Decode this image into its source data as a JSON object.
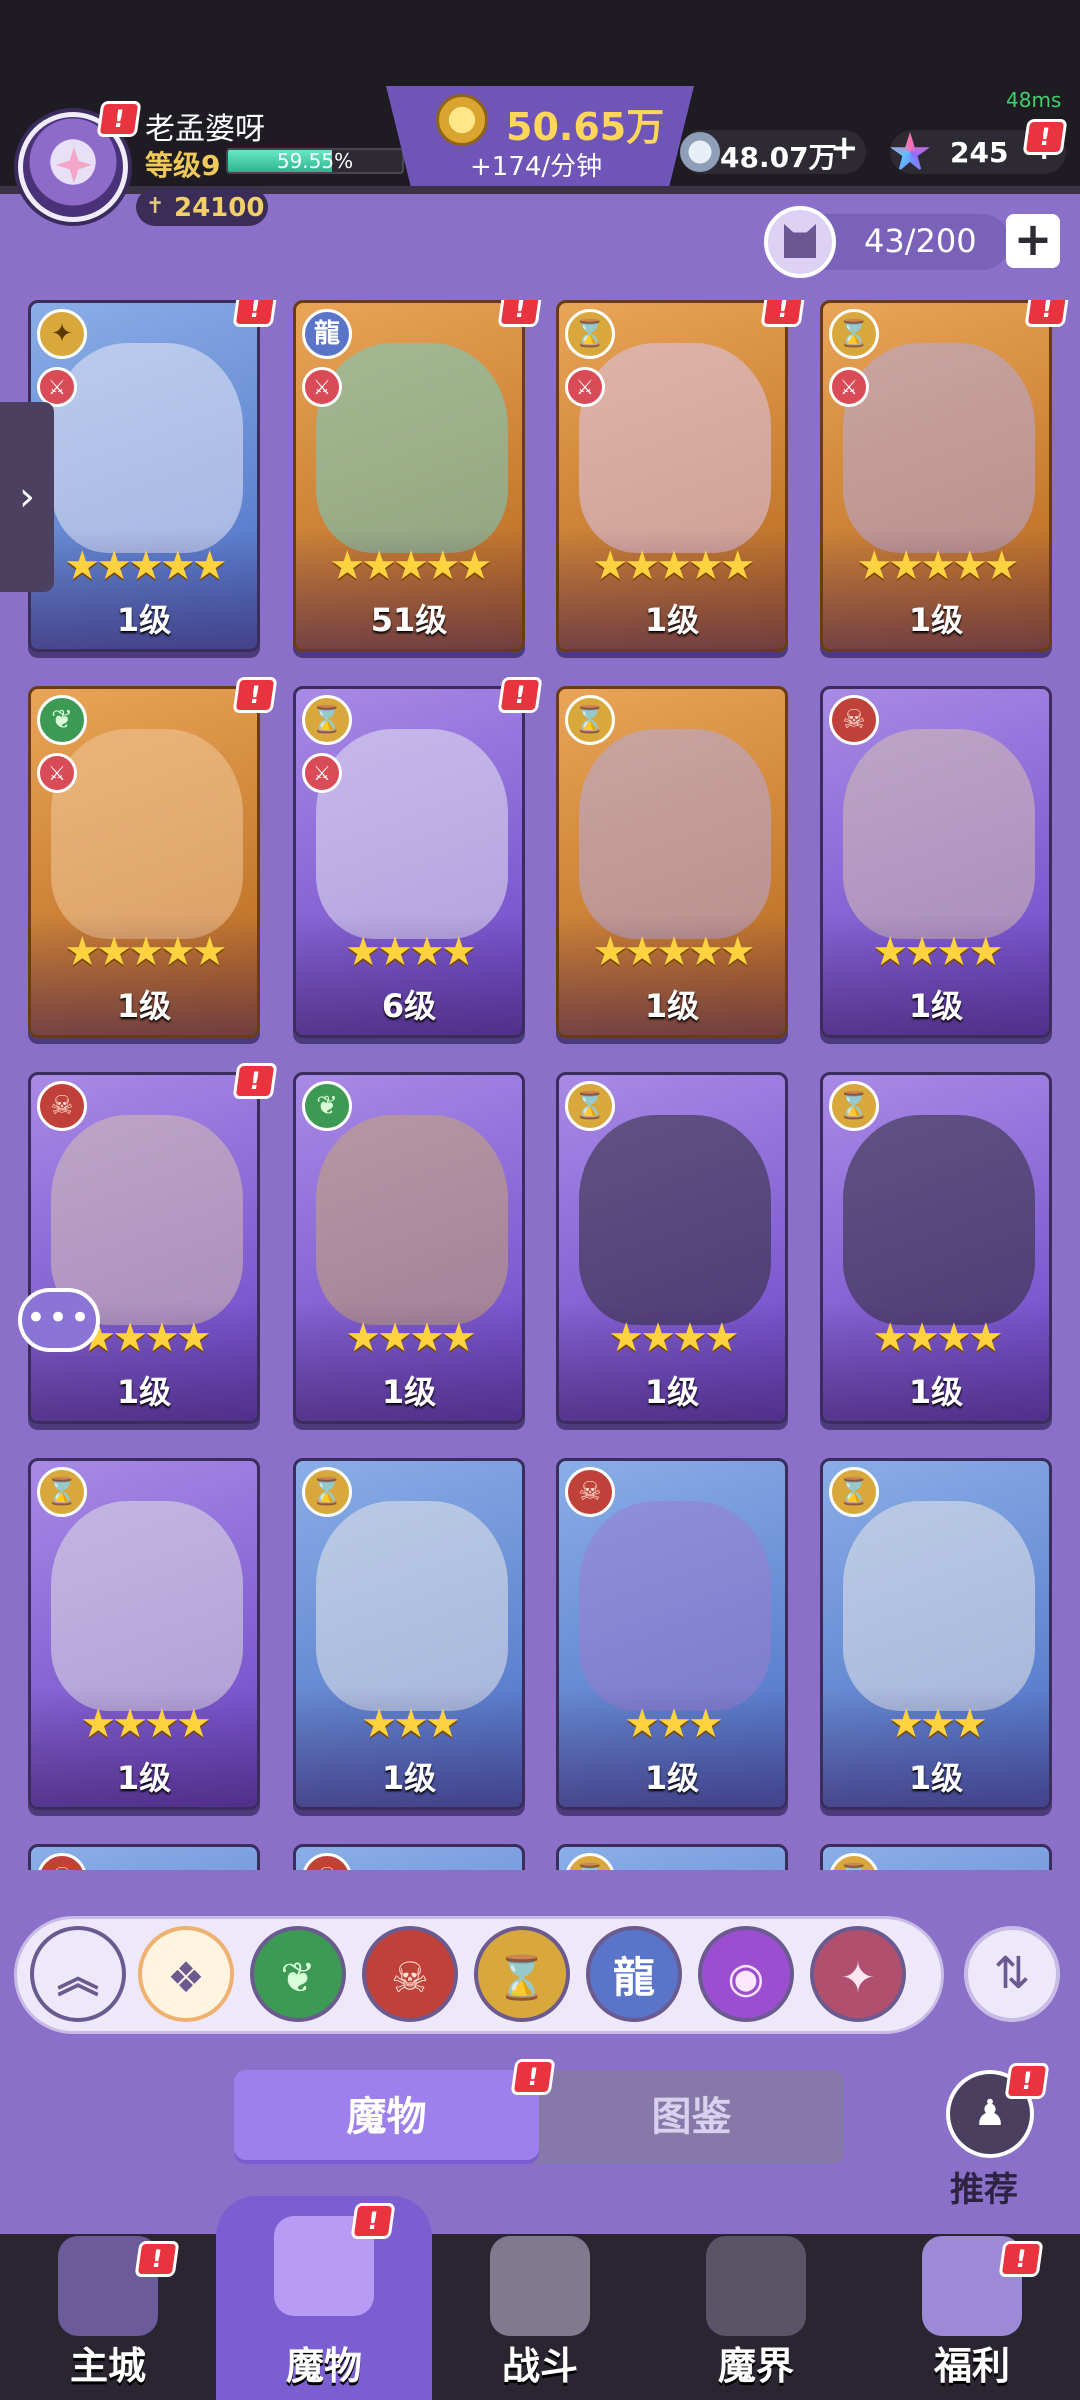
{
  "player": {
    "name": "老孟婆呀",
    "level": "等级9",
    "exp_text": "59.55%",
    "exp_fraction": 0.5955,
    "power": "24100"
  },
  "gold": {
    "amount": "50.65万",
    "rate": "+174/分钟"
  },
  "resources": [
    {
      "icon": "silver-coin-icon",
      "value": "48.07万"
    },
    {
      "icon": "star-crystal-icon",
      "value": "245"
    }
  ],
  "ping": "48ms",
  "capacity": {
    "text": "43/200"
  },
  "cards": [
    {
      "bg": "blue",
      "cls": "b-gold",
      "classIcon": "✦",
      "role": true,
      "stars": "★★★★★",
      "level": "1级",
      "alert": true
    },
    {
      "bg": "orange",
      "cls": "b-blue",
      "classIcon": "龍",
      "role": true,
      "stars": "★★★★★",
      "level": "51级",
      "alert": true
    },
    {
      "bg": "orange",
      "cls": "b-gold",
      "classIcon": "⌛",
      "role": true,
      "stars": "★★★★★",
      "level": "1级",
      "alert": true
    },
    {
      "bg": "orange",
      "cls": "b-gold",
      "classIcon": "⌛",
      "role": true,
      "stars": "★★★★★",
      "level": "1级",
      "alert": true
    },
    {
      "bg": "orange",
      "cls": "b-green",
      "classIcon": "❦",
      "role": true,
      "stars": "★★★★★",
      "level": "1级",
      "alert": true
    },
    {
      "bg": "purple",
      "cls": "b-gold",
      "classIcon": "⌛",
      "role": true,
      "stars": "★★★★",
      "level": "6级",
      "alert": true
    },
    {
      "bg": "orange",
      "cls": "b-gold",
      "classIcon": "⌛",
      "role": false,
      "stars": "★★★★★",
      "level": "1级",
      "alert": false
    },
    {
      "bg": "purple",
      "cls": "b-red",
      "classIcon": "☠",
      "role": false,
      "stars": "★★★★",
      "level": "1级",
      "alert": false
    },
    {
      "bg": "purple",
      "cls": "b-red",
      "classIcon": "☠",
      "role": false,
      "stars": "★★★★",
      "level": "1级",
      "alert": true
    },
    {
      "bg": "purple",
      "cls": "b-green",
      "classIcon": "❦",
      "role": false,
      "stars": "★★★★",
      "level": "1级",
      "alert": false
    },
    {
      "bg": "purple",
      "cls": "b-gold",
      "classIcon": "⌛",
      "role": false,
      "stars": "★★★★",
      "level": "1级",
      "alert": false
    },
    {
      "bg": "purple",
      "cls": "b-gold",
      "classIcon": "⌛",
      "role": false,
      "stars": "★★★★",
      "level": "1级",
      "alert": false
    },
    {
      "bg": "purple",
      "cls": "b-gold",
      "classIcon": "⌛",
      "role": false,
      "stars": "★★★★",
      "level": "1级",
      "alert": false
    },
    {
      "bg": "blue",
      "cls": "b-gold",
      "classIcon": "⌛",
      "role": false,
      "stars": "★★★",
      "level": "1级",
      "alert": false
    },
    {
      "bg": "blue",
      "cls": "b-red",
      "classIcon": "☠",
      "role": false,
      "stars": "★★★",
      "level": "1级",
      "alert": false
    },
    {
      "bg": "blue",
      "cls": "b-gold",
      "classIcon": "⌛",
      "role": false,
      "stars": "★★★",
      "level": "1级",
      "alert": false
    },
    {
      "bg": "blue",
      "cls": "b-red",
      "classIcon": "☠",
      "role": false,
      "stars": "",
      "level": "",
      "alert": false
    },
    {
      "bg": "blue",
      "cls": "b-red",
      "classIcon": "☠",
      "role": false,
      "stars": "",
      "level": "",
      "alert": false
    },
    {
      "bg": "blue",
      "cls": "b-gold",
      "classIcon": "⌛",
      "role": false,
      "stars": "",
      "level": "",
      "alert": false
    },
    {
      "bg": "blue",
      "cls": "b-gold",
      "classIcon": "⌛",
      "role": false,
      "stars": "",
      "level": "",
      "alert": false
    }
  ],
  "filters": [
    {
      "icon": "collapse-up-icon",
      "glyph": "︽",
      "color": "#ede8fa",
      "fg": "#6b5a8f"
    },
    {
      "icon": "all-types-icon",
      "glyph": "❖",
      "color": "#fff4e0",
      "fg": "#6b5a8f"
    },
    {
      "icon": "nature-icon",
      "glyph": "❦",
      "color": "#3c9a54",
      "fg": "#d9ffd9"
    },
    {
      "icon": "demon-icon",
      "glyph": "☠",
      "color": "#c0413a",
      "fg": "#ffe0d2"
    },
    {
      "icon": "hourglass-icon",
      "glyph": "⌛",
      "color": "#d8a83c",
      "fg": "#5a3a00"
    },
    {
      "icon": "dragon-icon",
      "glyph": "龍",
      "color": "#5a74c9",
      "fg": "#fff"
    },
    {
      "icon": "eye-icon",
      "glyph": "◉",
      "color": "#9b4fd0",
      "fg": "#ffe6ff"
    },
    {
      "icon": "shuriken-icon",
      "glyph": "✦",
      "color": "#b0506e",
      "fg": "#ffe6f0"
    }
  ],
  "tabs": {
    "monsters": "魔物",
    "codex": "图鉴"
  },
  "recommend_label": "推荐",
  "nav": [
    {
      "label": "主城",
      "icon": "castle-icon"
    },
    {
      "label": "魔物",
      "icon": "monster-flame-icon"
    },
    {
      "label": "战斗",
      "icon": "battle-shield-icon"
    },
    {
      "label": "魔界",
      "icon": "locked-realm-icon"
    },
    {
      "label": "福利",
      "icon": "treasure-chest-icon"
    }
  ],
  "colors": {
    "bg": "#8b70c9",
    "hud": "#1e1b22",
    "alert": "#e9333f",
    "gold": "#ffd65a",
    "nav_active": "#7b5ed0"
  }
}
